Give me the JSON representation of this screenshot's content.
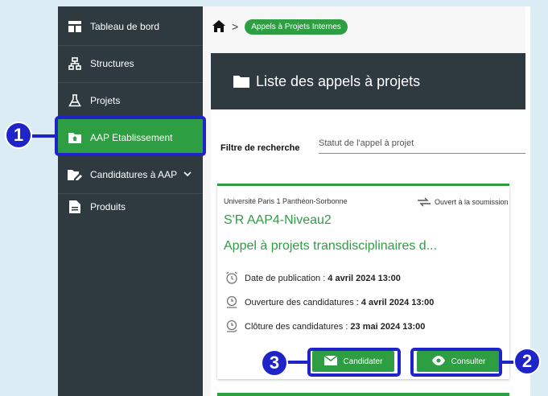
{
  "sidebar": {
    "items": [
      {
        "label": "Tableau de bord",
        "icon": "dashboard-icon"
      },
      {
        "label": "Structures",
        "icon": "sitemap-icon"
      },
      {
        "label": "Projets",
        "icon": "flask-icon"
      },
      {
        "label": "AAP Etablissement",
        "icon": "folder-home-icon",
        "active": true
      },
      {
        "label": "Candidatures à AAP",
        "icon": "folder-edit-icon"
      },
      {
        "label": "Produits",
        "icon": "document-icon"
      }
    ]
  },
  "breadcrumb": {
    "separator": ">",
    "current": "Appels à Projets Internes"
  },
  "panel": {
    "title": "Liste des appels à projets"
  },
  "filter": {
    "label": "Filtre de recherche",
    "placeholder": "Statut de l'appel à projet"
  },
  "card": {
    "organization": "Université Paris 1 Panthéon-Sorbonne",
    "status": "Ouvert à la soumission",
    "code": "S'R AAP4-Niveau2",
    "title": "Appel à projets transdisciplinaires d...",
    "dates": [
      {
        "label": "Date de publication :",
        "value": "4 avril 2024 13:00"
      },
      {
        "label": "Ouverture des candidatures :",
        "value": "4 avril 2024 13:00"
      },
      {
        "label": "Clôture des candidatures :",
        "value": "23 mai 2024 13:00"
      }
    ],
    "apply_label": "Candidater",
    "view_label": "Consulter"
  },
  "callouts": [
    "1",
    "2",
    "3"
  ],
  "colors": {
    "sidebar_bg": "#2f3a40",
    "accent_green": "#2e9e43",
    "callout_blue": "#1f24c8",
    "page_bg": "#dcecf4"
  }
}
